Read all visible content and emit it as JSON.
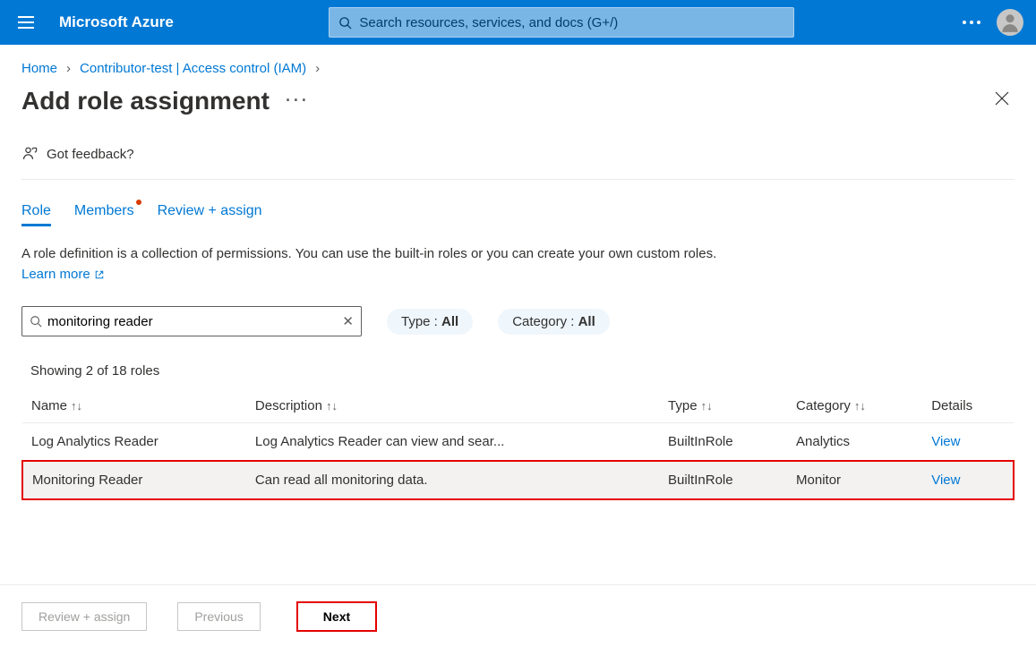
{
  "header": {
    "brand": "Microsoft Azure",
    "search_placeholder": "Search resources, services, and docs (G+/)"
  },
  "breadcrumb": {
    "home": "Home",
    "current": "Contributor-test | Access control (IAM)"
  },
  "page": {
    "title": "Add role assignment",
    "feedback": "Got feedback?"
  },
  "tabs": {
    "role": "Role",
    "members": "Members",
    "review": "Review + assign"
  },
  "description": {
    "text_part1": "A role definition is a collection of permissions. You can use the built-in roles or you can create your own custom roles. ",
    "learn_more": "Learn more"
  },
  "filters": {
    "search_value": "monitoring reader",
    "type_label": "Type : ",
    "type_value": "All",
    "category_label": "Category : ",
    "category_value": "All"
  },
  "showing": "Showing 2 of 18 roles",
  "columns": {
    "name": "Name",
    "description": "Description",
    "type": "Type",
    "category": "Category",
    "details": "Details"
  },
  "rows": [
    {
      "name": "Log Analytics Reader",
      "description": "Log Analytics Reader can view and sear...",
      "type": "BuiltInRole",
      "category": "Analytics",
      "details": "View"
    },
    {
      "name": "Monitoring Reader",
      "description": "Can read all monitoring data.",
      "type": "BuiltInRole",
      "category": "Monitor",
      "details": "View"
    }
  ],
  "footer": {
    "review": "Review + assign",
    "previous": "Previous",
    "next": "Next"
  }
}
